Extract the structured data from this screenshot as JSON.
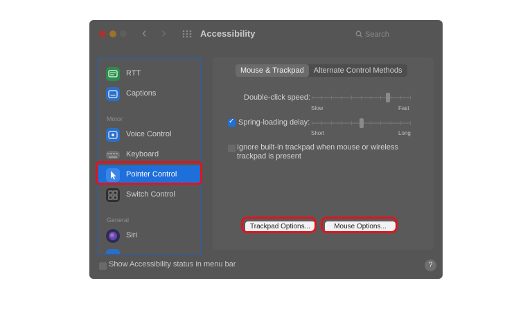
{
  "window": {
    "title": "Accessibility",
    "search_placeholder": "Search",
    "back_glyph": "‹",
    "forward_glyph": "›"
  },
  "sidebar": {
    "items_top": [
      {
        "label": "RTT",
        "icon": "rtt-icon",
        "color": "#2e8b4e"
      },
      {
        "label": "Captions",
        "icon": "captions-icon",
        "color": "#2a6fc7"
      }
    ],
    "section_motor": "Motor",
    "items_motor": [
      {
        "label": "Voice Control",
        "icon": "voice-control-icon",
        "color": "#2a6fc7"
      },
      {
        "label": "Keyboard",
        "icon": "keyboard-icon",
        "color": "#7a7a7a"
      },
      {
        "label": "Pointer Control",
        "icon": "pointer-icon",
        "color": "#2a6fc7"
      },
      {
        "label": "Switch Control",
        "icon": "switch-control-icon",
        "color": "#333333"
      }
    ],
    "section_general": "General",
    "items_general": [
      {
        "label": "Siri",
        "icon": "siri-icon",
        "color": "#3b3b6b"
      }
    ],
    "selected": "Pointer Control"
  },
  "pane": {
    "tabs": [
      "Mouse & Trackpad",
      "Alternate Control Methods"
    ],
    "active_tab": "Mouse & Trackpad",
    "double_click": {
      "label": "Double-click speed:",
      "min": "Slow",
      "max": "Fast",
      "value": 0.78
    },
    "spring_loading": {
      "label": "Spring-loading delay:",
      "min": "Short",
      "max": "Long",
      "value": 0.5,
      "checked": true
    },
    "ignore_trackpad": {
      "label_line1": "Ignore built-in trackpad when mouse or wireless",
      "label_line2": "trackpad is present",
      "checked": false
    },
    "trackpad_options": "Trackpad Options...",
    "mouse_options": "Mouse Options..."
  },
  "footer": {
    "show_status": "Show Accessibility status in menu bar",
    "help": "?"
  },
  "colors": {
    "highlight": "#e0141e",
    "selection": "#1e6fd9",
    "window_bg": "#555555"
  }
}
